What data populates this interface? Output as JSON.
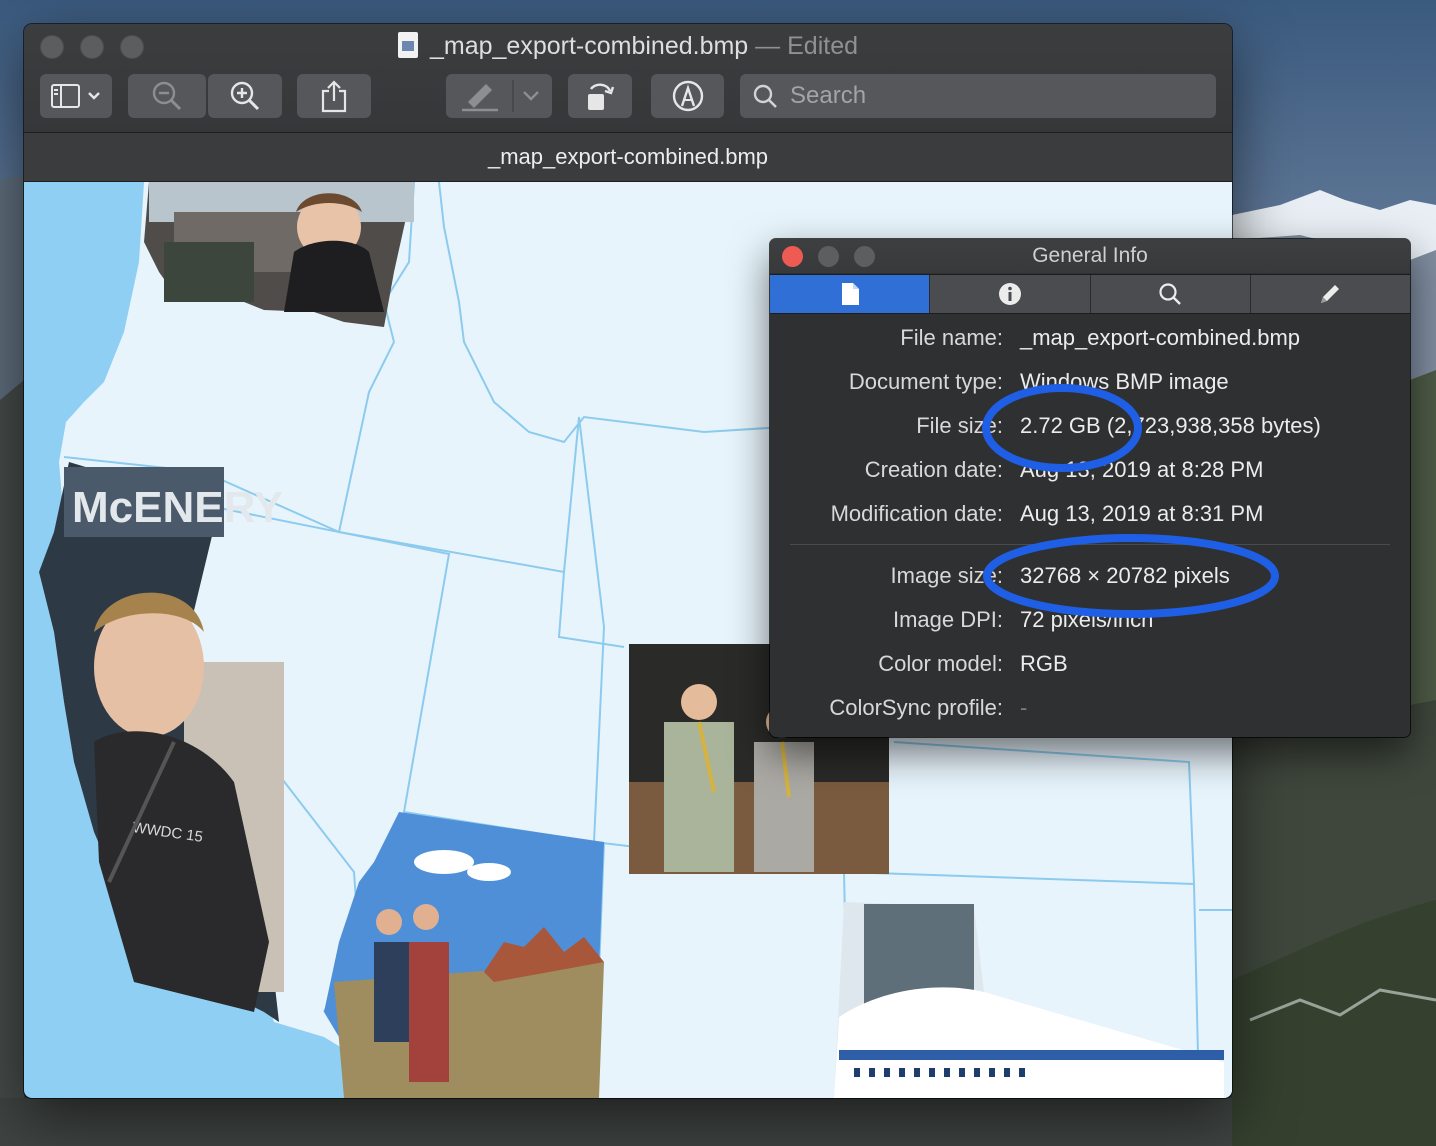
{
  "window": {
    "title": "_map_export-combined.bmp",
    "title_suffix": "— Edited",
    "tab_title": "_map_export-combined.bmp"
  },
  "toolbar": {
    "sidebar_icon": "sidebar-toggle-icon",
    "zoom_out_icon": "zoom-out-icon",
    "zoom_in_icon": "zoom-in-icon",
    "share_icon": "share-icon",
    "highlight_icon": "highlighter-icon",
    "rotate_icon": "rotate-icon",
    "markup_icon": "markup-icon",
    "search_placeholder": "Search"
  },
  "inspector": {
    "title": "General Info",
    "tabs": [
      "document-icon",
      "info-icon",
      "magnifier-icon",
      "pencil-icon"
    ],
    "rows": [
      {
        "label": "File name:",
        "value": "_map_export-combined.bmp"
      },
      {
        "label": "Document type:",
        "value": "Windows BMP image"
      },
      {
        "label": "File size:",
        "value": "2.72 GB (2,723,938,358 bytes)"
      },
      {
        "label": "Creation date:",
        "value": "Aug 13, 2019 at 8:28 PM"
      },
      {
        "label": "Modification date:",
        "value": "Aug 13, 2019 at 8:31 PM"
      },
      {
        "label": "Image size:",
        "value": "32768 × 20782 pixels"
      },
      {
        "label": "Image DPI:",
        "value": "72 pixels/inch"
      },
      {
        "label": "Color model:",
        "value": "RGB"
      },
      {
        "label": "ColorSync profile:",
        "value": "-"
      }
    ]
  },
  "map_photos": {
    "jacket_text": "WWDC 15",
    "building_sign": "McENERY"
  },
  "colors": {
    "ocean": "#8ecff3",
    "land": "#e7f4fc",
    "borders": "#8ccbee",
    "annotation": "#1f5fe6",
    "active_tab": "#2f6fd6",
    "close_button": "#ed5b52"
  }
}
